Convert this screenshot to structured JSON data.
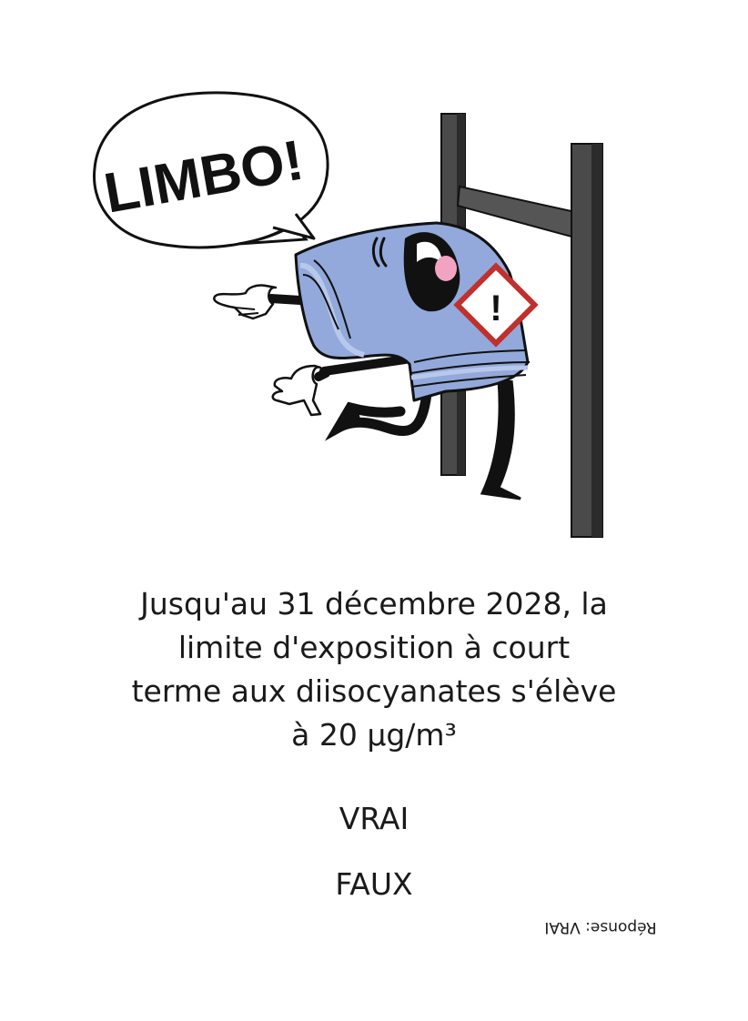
{
  "illustration": {
    "speech_bubble_text": "LIMBO!",
    "colors": {
      "character_body": "#93a9db",
      "character_stripe": "#b8c8ec",
      "outline": "#111111",
      "posts": "#4a4a4a",
      "warning_border": "#c0302c",
      "cheek": "#f2a3c2"
    },
    "icons": [
      "speech-bubble",
      "hazard-warning-sign",
      "limbo-bar"
    ]
  },
  "question": {
    "lines": [
      "Jusqu'au 31 décembre 2028, la",
      "limite d'exposition à court",
      "terme aux diisocyanates s'élève",
      "à 20 µg/m³"
    ]
  },
  "options": {
    "true_label": "VRAI",
    "false_label": "FAUX"
  },
  "answer": {
    "text": "Réponse: VRAI"
  }
}
